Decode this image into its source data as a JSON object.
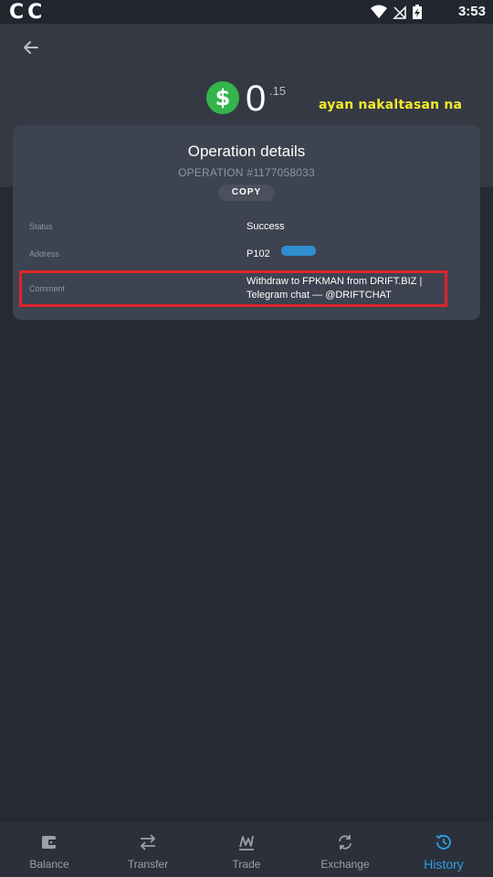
{
  "status_bar": {
    "left_icons": "CC",
    "time": "3:53"
  },
  "header": {
    "back_icon": "arrow-left-icon"
  },
  "balance": {
    "currency_icon": "$",
    "integer": "0",
    "fraction": ".15"
  },
  "annotation": "ayan nakaltasan na",
  "operation": {
    "title": "Operation details",
    "number": "OPERATION #1177058033",
    "copy_label": "COPY",
    "rows": [
      {
        "label": "Status",
        "value": "Success"
      },
      {
        "label": "Address",
        "value": "P102"
      },
      {
        "label": "Comment",
        "value_line1": "Withdraw to FPKMAN from DRIFT.BIZ |",
        "value_line2": "Telegram chat — @DRIFTCHAT"
      }
    ]
  },
  "colors": {
    "accent_active": "#2fa0e8",
    "success_green": "#34b54c",
    "highlight_red": "#e0242c",
    "annotation_yellow": "#f3ea2b"
  },
  "bottom_nav": [
    {
      "label": "Balance",
      "icon": "wallet-icon"
    },
    {
      "label": "Transfer",
      "icon": "transfer-arrows-icon"
    },
    {
      "label": "Trade",
      "icon": "trade-chart-icon"
    },
    {
      "label": "Exchange",
      "icon": "exchange-cycle-icon"
    },
    {
      "label": "History",
      "icon": "history-clock-icon",
      "active": true
    }
  ]
}
